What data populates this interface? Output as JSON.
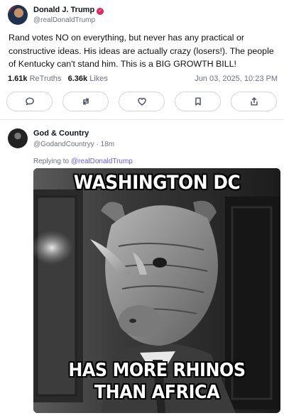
{
  "post": {
    "author_name": "Donald J. Trump",
    "author_handle": "@realDonaldTrump",
    "verified_icon": "verified-badge-icon",
    "body": "Rand votes NO on everything, but never has any practical or constructive ideas. His ideas are actually crazy (losers!). The people of Kentucky can't stand him. This is a BIG GROWTH BILL!",
    "retruths_count": "1.61k",
    "retruths_label": "ReTruths",
    "likes_count": "6.36k",
    "likes_label": "Likes",
    "timestamp": "Jun 03, 2025, 10:23 PM",
    "actions": [
      {
        "name": "reply",
        "icon": "speech-bubble-icon"
      },
      {
        "name": "retruth",
        "icon": "repost-arrows-icon"
      },
      {
        "name": "like",
        "icon": "heart-icon"
      },
      {
        "name": "bookmark",
        "icon": "bookmark-icon"
      },
      {
        "name": "share",
        "icon": "share-upload-icon"
      }
    ]
  },
  "reply": {
    "author_name": "God & Country",
    "author_handle": "@GodandCountryy",
    "time_ago": "18m",
    "replying_prefix": "Replying to ",
    "replying_to": "@realDonaldTrump",
    "meme": {
      "top_text": "WASHINGTON DC",
      "bottom_line_1": "HAS MORE RHINOS",
      "bottom_line_2": "THAN AFRICA"
    }
  },
  "colors": {
    "accent_purple": "#6d5ce8",
    "verified_red": "#e0245e",
    "muted_text": "#6b7280",
    "border": "#d1d5db"
  }
}
